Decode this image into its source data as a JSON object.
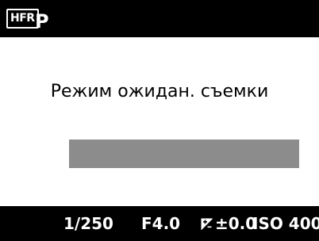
{
  "header": {
    "hfr_badge": "HFR",
    "mode": "P"
  },
  "main": {
    "status_text": "Режим ожидан. съемки",
    "progress": 0
  },
  "footer": {
    "shutter_speed": "1/250",
    "aperture": "F4.0",
    "exposure_icon": "exposure-compensation-icon",
    "exposure_value": "±0.0",
    "iso": "ISO 400"
  },
  "colors": {
    "bars": "#000000",
    "background": "#ffffff",
    "progress_track": "#8c8c8c"
  }
}
